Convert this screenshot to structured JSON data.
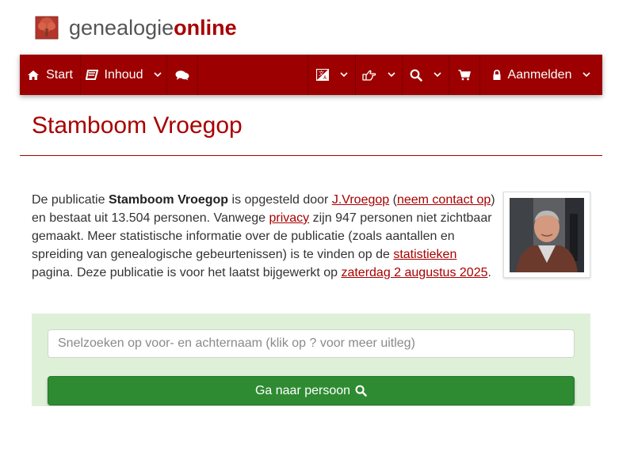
{
  "site": {
    "logo_text_a": "genealogie",
    "logo_text_b": "online"
  },
  "nav": {
    "start_label": "Start",
    "inhoud_label": "Inhoud",
    "aanmelden_label": "Aanmelden"
  },
  "page": {
    "title": "Stamboom Vroegop"
  },
  "intro": {
    "t1": "De publicatie ",
    "pub_name": "Stamboom Vroegop",
    "t2": " is opgesteld door ",
    "author_link": "J.Vroegop",
    "t3": " (",
    "contact_link": "neem contact op",
    "t4": ") en bestaat uit 13.504 personen. Vanwege ",
    "privacy_link": "privacy",
    "t5": " zijn 947 personen niet zichtbaar gemaakt. Meer statistische informatie over de publicatie (zoals aantallen en spreiding van genealogische gebeurtenissen) is te vinden op de ",
    "stats_link": "statistieken",
    "t6": " pagina. Deze publicatie is voor het laatst bijgewerkt op ",
    "date_link": "zaterdag 2 augustus 2025",
    "t7": "."
  },
  "search": {
    "placeholder": "Snelzoeken op voor- en achternaam (klik op ? voor meer uitleg)",
    "button_label": "Ga naar persoon"
  },
  "colors": {
    "brand": "#9c0000",
    "title": "#a80000",
    "panel": "#dff0d8",
    "button": "#2e8b32"
  },
  "icons": [
    "tree-icon",
    "home-icon",
    "book-icon",
    "chevron-down-icon",
    "comments-icon",
    "language-icon",
    "hand-pointer-icon",
    "search-icon",
    "cart-icon",
    "lock-icon"
  ]
}
